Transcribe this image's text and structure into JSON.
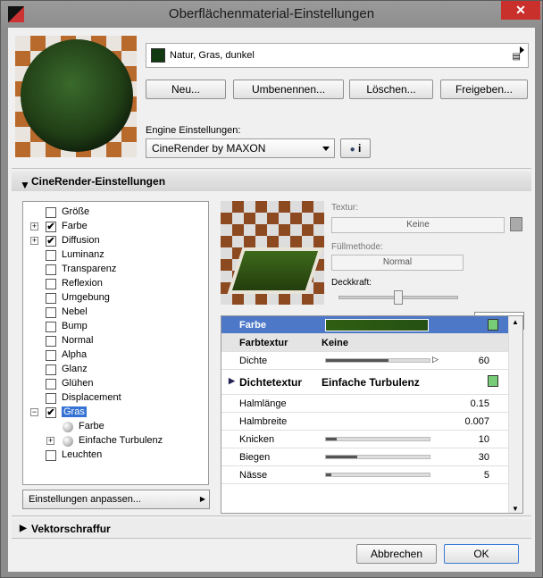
{
  "window": {
    "title": "Oberflächenmaterial-Einstellungen",
    "close": "✕"
  },
  "material": {
    "name": "Natur, Gras, dunkel",
    "swatch_color": "#123a12"
  },
  "buttons": {
    "new": "Neu...",
    "rename": "Umbenennen...",
    "delete": "Löschen...",
    "share": "Freigeben..."
  },
  "engine": {
    "label": "Engine Einstellungen:",
    "value": "CineRender by MAXON",
    "info": "i"
  },
  "section1": {
    "title": "CineRender-Einstellungen"
  },
  "tree": [
    {
      "label": "Größe",
      "checked": false
    },
    {
      "label": "Farbe",
      "checked": true,
      "plus": true
    },
    {
      "label": "Diffusion",
      "checked": true,
      "plus": true
    },
    {
      "label": "Luminanz",
      "checked": false
    },
    {
      "label": "Transparenz",
      "checked": false
    },
    {
      "label": "Reflexion",
      "checked": false
    },
    {
      "label": "Umgebung",
      "checked": false
    },
    {
      "label": "Nebel",
      "checked": false
    },
    {
      "label": "Bump",
      "checked": false
    },
    {
      "label": "Normal",
      "checked": false
    },
    {
      "label": "Alpha",
      "checked": false
    },
    {
      "label": "Glanz",
      "checked": false
    },
    {
      "label": "Glühen",
      "checked": false
    },
    {
      "label": "Displacement",
      "checked": false
    },
    {
      "label": "Gras",
      "checked": true,
      "expanded": true
    },
    {
      "label": "Farbe",
      "child": true
    },
    {
      "label": "Einfache Turbulenz",
      "child": true,
      "plus": true
    },
    {
      "label": "Leuchten",
      "checked": false
    }
  ],
  "adjust_button": "Einstellungen anpassen...",
  "texture": {
    "label": "Textur:",
    "value": "Keine"
  },
  "fill": {
    "label": "Füllmethode:",
    "value": "Normal"
  },
  "opacity": {
    "label": "Deckkraft:",
    "value": "50.0000",
    "level": 0.5
  },
  "props": {
    "farbe": "Farbe",
    "farbtextur": {
      "label": "Farbtextur",
      "value": "Keine"
    },
    "dichte": {
      "label": "Dichte",
      "value": "60",
      "level": 0.6
    },
    "dichtetextur": {
      "label": "Dichtetextur",
      "value": "Einfache Turbulenz"
    },
    "halmlaenge": {
      "label": "Halmlänge",
      "value": "0.15"
    },
    "halmbreite": {
      "label": "Halmbreite",
      "value": "0.007"
    },
    "knicken": {
      "label": "Knicken",
      "value": "10",
      "level": 0.1
    },
    "biegen": {
      "label": "Biegen",
      "value": "30",
      "level": 0.3
    },
    "naesse": {
      "label": "Nässe",
      "value": "5",
      "level": 0.05
    }
  },
  "section2": {
    "title": "Vektorschraffur"
  },
  "footer": {
    "cancel": "Abbrechen",
    "ok": "OK"
  }
}
